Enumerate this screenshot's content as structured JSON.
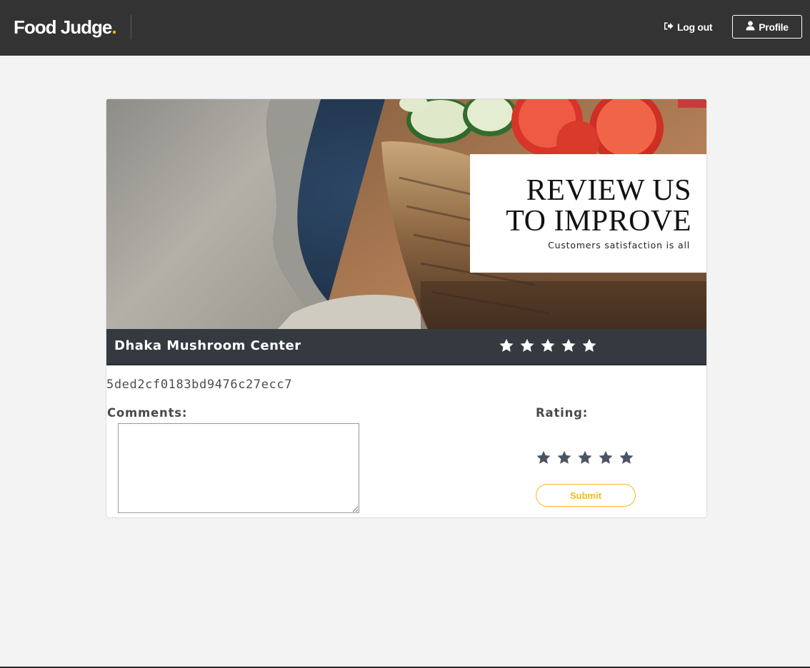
{
  "header": {
    "brand": "Food Judge",
    "brand_dot": ".",
    "logout_label": "Log out",
    "profile_label": "Profile",
    "logout_icon": "sign-out-icon",
    "profile_icon": "user-icon"
  },
  "banner": {
    "title": "REVIEW US\nTO IMPROVE",
    "subtitle": "Customers satisfaction is all"
  },
  "restaurant": {
    "name": "Dhaka Mushroom Center",
    "id": "5ded2cf0183bd9476c27ecc7",
    "average_rating": 5,
    "max_rating": 5
  },
  "review_form": {
    "comments_label": "Comments:",
    "comments_value": "",
    "rating_label": "Rating:",
    "rating_value": 0,
    "max_rating": 5,
    "submit_label": "Submit"
  },
  "colors": {
    "header_bg": "#333333",
    "accent": "#f5b81c",
    "namebar_bg": "#343a40",
    "page_bg": "#f3f3f3",
    "rating_star": "#4a5562"
  }
}
